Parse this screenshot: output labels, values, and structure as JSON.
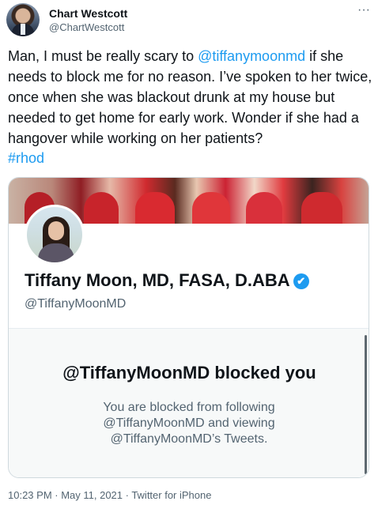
{
  "author": {
    "display_name": "Chart Westcott",
    "handle": "@ChartWestcott"
  },
  "more_icon": "···",
  "tweet": {
    "part1": "Man, I must be really scary to ",
    "mention": "@tiffanymoonmd",
    "part2": " if she needs to block me for no reason.  I’ve spoken to her twice, once when she was blackout drunk at my house but needed to get home for early work.  Wonder if she had a hangover while working on her patients?",
    "hashtag": "#rhod"
  },
  "card": {
    "profile_name": "Tiffany Moon, MD, FASA, D.ABA",
    "verified_glyph": "✔",
    "profile_handle": "@TiffanyMoonMD",
    "blocked_title": "@TiffanyMoonMD blocked you",
    "blocked_desc": "You are blocked from following @TiffanyMoonMD and viewing @TiffanyMoonMD’s Tweets."
  },
  "meta": "10:23 PM · May 11, 2021 · Twitter for iPhone",
  "colors": {
    "link": "#1d9bf0",
    "secondary_text": "#536471",
    "verified": "#1d9bf0"
  }
}
